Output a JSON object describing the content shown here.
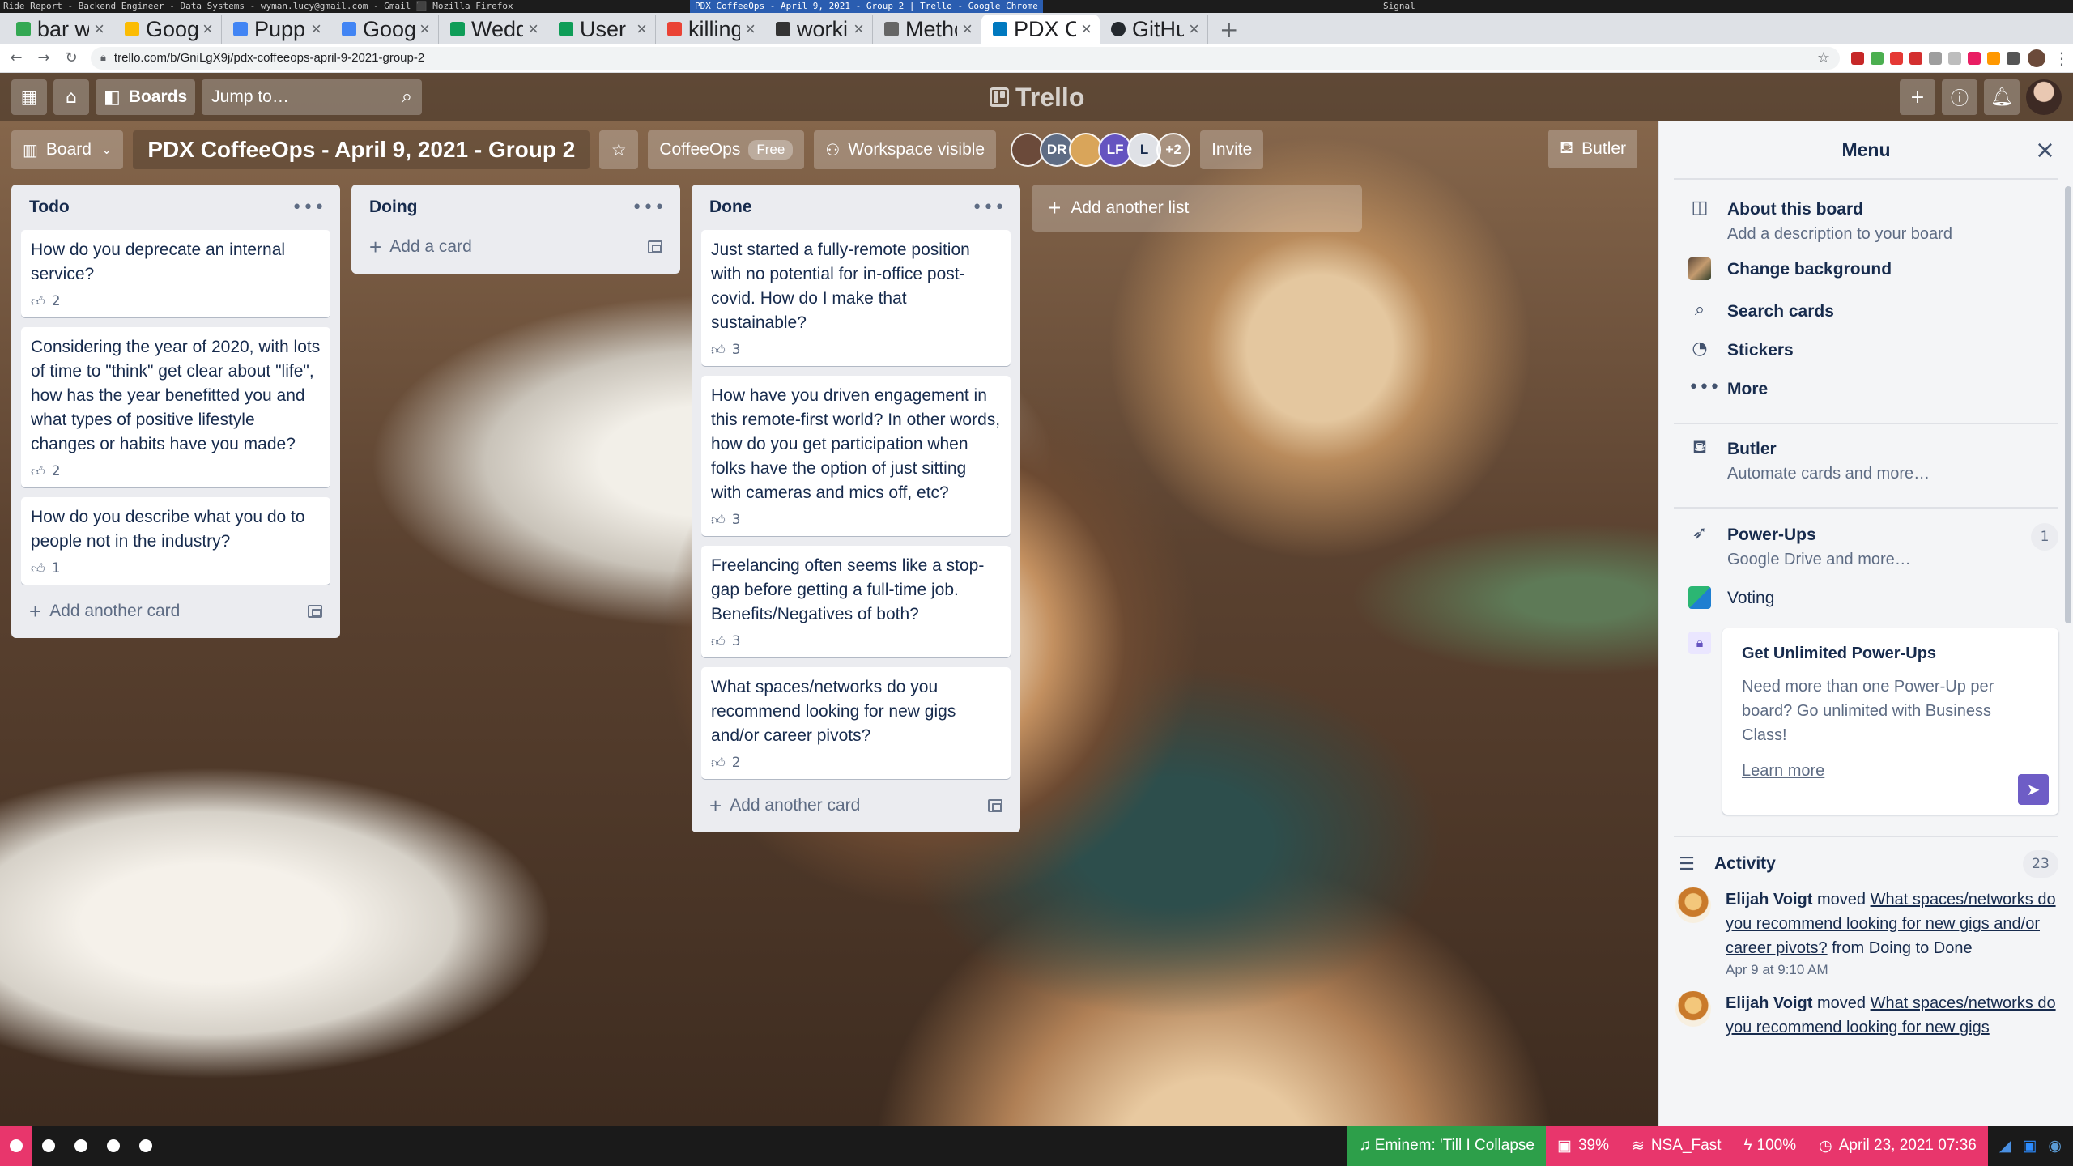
{
  "wm": {
    "left": "Ride Report - Backend Engineer - Data Systems - wyman.lucy@gmail.com - Gmail ⬛ Mozilla Firefox",
    "center": "PDX CoffeeOps - April 9, 2021 - Group 2 | Trello - Google Chrome",
    "right": "Signal"
  },
  "tabs": [
    {
      "title": "bar with outdo",
      "color": "#34a853"
    },
    {
      "title": "Google Keep",
      "color": "#fbbc04"
    },
    {
      "title": "Puppet - Calen",
      "color": "#4285f4"
    },
    {
      "title": "Google Calen",
      "color": "#4285f4"
    },
    {
      "title": "Wedding - Goo",
      "color": "#0f9d58"
    },
    {
      "title": "User questio",
      "color": "#0f9d58"
    },
    {
      "title": "killing himala",
      "color": "#ea4335"
    },
    {
      "title": "working_HBE",
      "color": "#333333"
    },
    {
      "title": "Methods to c",
      "color": "#666666"
    },
    {
      "title": "PDX CoffeeO",
      "color": "#0079bf",
      "active": true
    },
    {
      "title": "GitHub - lucy",
      "color": "#24292e"
    }
  ],
  "address": {
    "url": "trello.com/b/GniLgX9j/pdx-coffeeops-april-9-2021-group-2"
  },
  "header": {
    "boards_label": "Boards",
    "jump_placeholder": "Jump to…",
    "logo_text": "Trello"
  },
  "boardbar": {
    "view_label": "Board",
    "title": "PDX CoffeeOps - April 9, 2021 - Group 2",
    "workspace": "CoffeeOps",
    "plan": "Free",
    "visibility": "Workspace visible",
    "members": [
      {
        "initials": "",
        "color": "#6b4a3a"
      },
      {
        "initials": "DR",
        "color": "#5e6c84"
      },
      {
        "initials": "",
        "color": "#d9a55a"
      },
      {
        "initials": "LF",
        "color": "#6554c0"
      },
      {
        "initials": "L",
        "color": "#dfe1e6"
      }
    ],
    "more_members": "+2",
    "invite_label": "Invite",
    "butler_label": "Butler"
  },
  "lists": [
    {
      "title": "Todo",
      "cards": [
        {
          "text": "How do you deprecate an internal service?",
          "votes": "2"
        },
        {
          "text": "Considering the year of 2020, with lots of time to \"think\" get clear about \"life\", how has the year benefitted you and what types of positive lifestyle changes or habits have you made?",
          "votes": "2"
        },
        {
          "text": "How do you describe what you do to people not in the industry?",
          "votes": "1"
        }
      ],
      "add_label": "Add another card"
    },
    {
      "title": "Doing",
      "cards": [],
      "add_label": "Add a card"
    },
    {
      "title": "Done",
      "cards": [
        {
          "text": "Just started a fully-remote position with no potential for in-office post-covid. How do I make that sustainable?",
          "votes": "3"
        },
        {
          "text": "How have you driven engagement in this remote-first world? In other words, how do you get participation when folks have the option of just sitting with cameras and mics off, etc?",
          "votes": "3"
        },
        {
          "text": "Freelancing often seems like a stop-gap before getting a full-time job. Benefits/Negatives of both?",
          "votes": "3"
        },
        {
          "text": "What spaces/networks do you recommend looking for new gigs and/or career pivots?",
          "votes": "2"
        }
      ],
      "add_label": "Add another card"
    }
  ],
  "add_list_label": "Add another list",
  "menu": {
    "title": "Menu",
    "about": {
      "label": "About this board",
      "sub": "Add a description to your board"
    },
    "change_bg": "Change background",
    "search_cards": "Search cards",
    "stickers": "Stickers",
    "more": "More",
    "butler": {
      "label": "Butler",
      "sub": "Automate cards and more…"
    },
    "powerups": {
      "label": "Power-Ups",
      "sub": "Google Drive and more…",
      "count": "1"
    },
    "voting": "Voting",
    "promo": {
      "title": "Get Unlimited Power-Ups",
      "text": "Need more than one Power-Up per board? Go unlimited with Business Class!",
      "link": "Learn more"
    },
    "activity": {
      "label": "Activity",
      "count": "23",
      "entries": [
        {
          "who": "Elijah Voigt",
          "verb": " moved ",
          "link": "What spaces/networks do you recommend looking for new gigs and/or career pivots?",
          "rest": " from Doing to Done",
          "time": "Apr 9 at 9:10 AM"
        },
        {
          "who": "Elijah Voigt",
          "verb": " moved ",
          "link": "What spaces/networks do you recommend looking for new gigs",
          "rest": "",
          "time": ""
        }
      ]
    }
  },
  "status": {
    "music": "♫ Eminem: 'Till I Collapse",
    "disk": "39%",
    "wifi": "NSA_Fast",
    "battery": "100%",
    "datetime": "April 23, 2021 07:36"
  },
  "colors": {
    "status_music": "#2d9f4a",
    "status_disk": "#e8366c",
    "status_wifi": "#e8366c",
    "status_battery": "#e8366c",
    "status_clock": "#e8366c"
  }
}
